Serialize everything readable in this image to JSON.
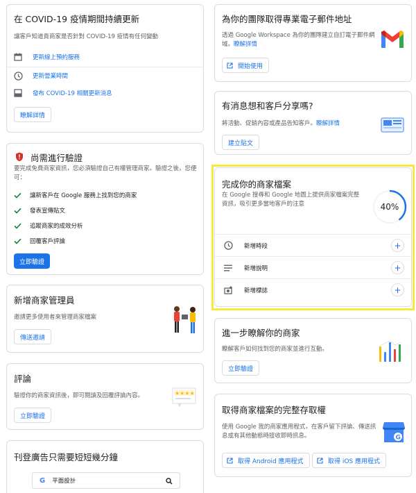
{
  "covid": {
    "title": "在 COVID-19 疫情期間持續更新",
    "desc": "讓客戶知道貴商家是否針對 COVID-19 疫情有任何變動",
    "items": [
      {
        "label": "更新線上預約服務"
      },
      {
        "label": "更新營業時間"
      },
      {
        "label": "發布 COVID-19 相關更新消息"
      }
    ],
    "button": "瞭解詳情"
  },
  "verify": {
    "title": "尚需進行驗證",
    "desc": "要完成免費商家資訊，您必須驗證自己有權管理商家。驗證之後，您便可：",
    "items": [
      {
        "label": "讓新客戶在 Google 服務上找到您的商家"
      },
      {
        "label": "發表宣傳貼文"
      },
      {
        "label": "追蹤商家的成效分析"
      },
      {
        "label": "回覆客戶評論"
      }
    ],
    "button": "立即驗證"
  },
  "managers": {
    "title": "新增商家管理員",
    "desc": "邀請更多使用者來管理商家檔案",
    "button": "傳送邀請"
  },
  "reviews": {
    "title": "評論",
    "desc": "驗證你的商家資訊後，即可閱讀及回覆評論內容。",
    "button": "立即驗證"
  },
  "ads": {
    "title": "刊登廣告只需要短短幾分鐘",
    "search_value": "平面設計"
  },
  "email": {
    "title": "為你的團隊取得專業電子郵件地址",
    "desc": "透過 Google Workspace 為你的團隊建立自訂電子郵件網域。",
    "link": "瞭解詳情",
    "button": "開始使用"
  },
  "share": {
    "title": "有消息想和客戶分享嗎?",
    "desc": "將活動、促銷內容或產品告知客戶。",
    "link": "瞭解詳情",
    "button": "建立貼文"
  },
  "profile": {
    "title": "完成你的商家檔案",
    "desc": "在 Google 搜尋和 Google 地圖上提供商家檔案完整資訊，吸引更多當地客戶的注意",
    "percent_label": "40%",
    "progress": 0.4,
    "tasks": [
      {
        "label": "新增時段",
        "plus": "+"
      },
      {
        "label": "新增說明",
        "plus": "+"
      },
      {
        "label": "新增標誌",
        "plus": "+"
      }
    ],
    "highlight_color": "#f7ea3c"
  },
  "insights": {
    "title": "進一步瞭解你的商家",
    "desc": "瞭解客戶如何找到您的商家並進行互動。",
    "button": "立即驗證"
  },
  "access": {
    "title": "取得商家檔案的完整存取權",
    "desc": "使用 Google 我的商家應用程式，在客戶留下評論、傳送訊息或有其他動態時接收即時訊息。",
    "android_button": "取得 Android 應用程式",
    "ios_button": "取得 iOS 應用程式"
  },
  "colors": {
    "accent": "#1a73e8",
    "success": "#188038",
    "danger": "#d93025",
    "border": "#dadce0"
  }
}
